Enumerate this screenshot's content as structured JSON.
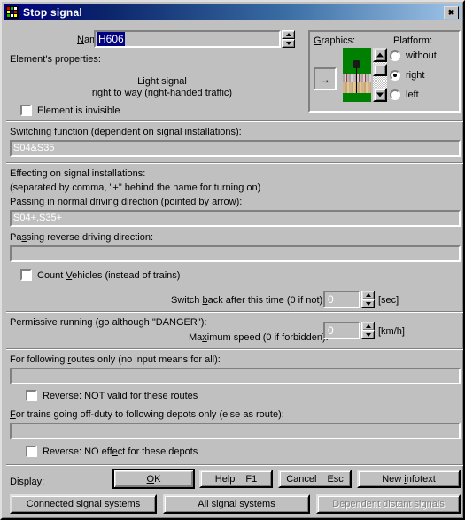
{
  "window": {
    "title": "Stop signal",
    "close_label": "Close",
    "icon": "signal-lights-icon"
  },
  "name_row": {
    "label": "Name:",
    "label_accel": "N",
    "value": "H606",
    "spinner_up": "up-arrow-icon",
    "spinner_down": "down-arrow-icon"
  },
  "properties": {
    "heading": "Element's properties:",
    "line1": "Light signal",
    "line2": "right to way (right-handed traffic)",
    "invisible_checkbox": {
      "label": "Element is invisible",
      "checked": false
    }
  },
  "graphics": {
    "label": "Graphics:",
    "prev_button": "→",
    "scroll_up": "up-arrow-icon",
    "scroll_down": "down-arrow-icon"
  },
  "platform": {
    "label": "Platform:",
    "options": [
      {
        "label": "without",
        "selected": false
      },
      {
        "label": "right",
        "selected": true
      },
      {
        "label": "left",
        "selected": false
      }
    ]
  },
  "switching": {
    "label": "Switching function (dependent on signal installations):",
    "value": "S04&S35"
  },
  "effecting": {
    "heading": "Effecting on signal installations:",
    "hint": "(separated by comma, \"+\" behind the name for turning on)",
    "forward_label": "Passing in normal driving direction (pointed by arrow):",
    "forward_value": "S04+,S35+",
    "reverse_label": "Passing reverse driving direction:",
    "reverse_value": ""
  },
  "count_vehicles": {
    "label": "Count Vehicles (instead of trains)",
    "checked": false
  },
  "switch_back": {
    "label": "Switch back after this time (0 if not):",
    "value": "0",
    "unit": "[sec]"
  },
  "permissive": {
    "heading": "Permissive running (go although \"DANGER\"):",
    "speed_label": "Maximum speed (0 if forbidden):",
    "speed_value": "0",
    "unit": "[km/h]"
  },
  "routes": {
    "label": "For following routes only (no input means for all):",
    "value": "",
    "reverse_checkbox": {
      "label": "Reverse: NOT valid for these routes",
      "checked": false
    }
  },
  "depots": {
    "label": "For trains going off-duty to following depots only (else as route):",
    "value": "",
    "reverse_checkbox": {
      "label": "Reverse: NO effect for these depots",
      "checked": false
    }
  },
  "footer": {
    "display_label": "Display:",
    "ok": "OK",
    "help": "Help",
    "help_key": "F1",
    "cancel": "Cancel",
    "cancel_key": "Esc",
    "new_infotext": "New infotext",
    "connected_signal_systems": "Connected signal systems",
    "all_signal_systems": "All signal systems",
    "dependent_distant_signals": "Dependent distant signals"
  },
  "colors": {
    "face": "#c0c0c0",
    "title_start": "#00007f",
    "title_end": "#9fc4e8",
    "field_text": "#ffffff",
    "selection": "#000080",
    "disabled": "#808080",
    "terrain_green": "#008000"
  }
}
